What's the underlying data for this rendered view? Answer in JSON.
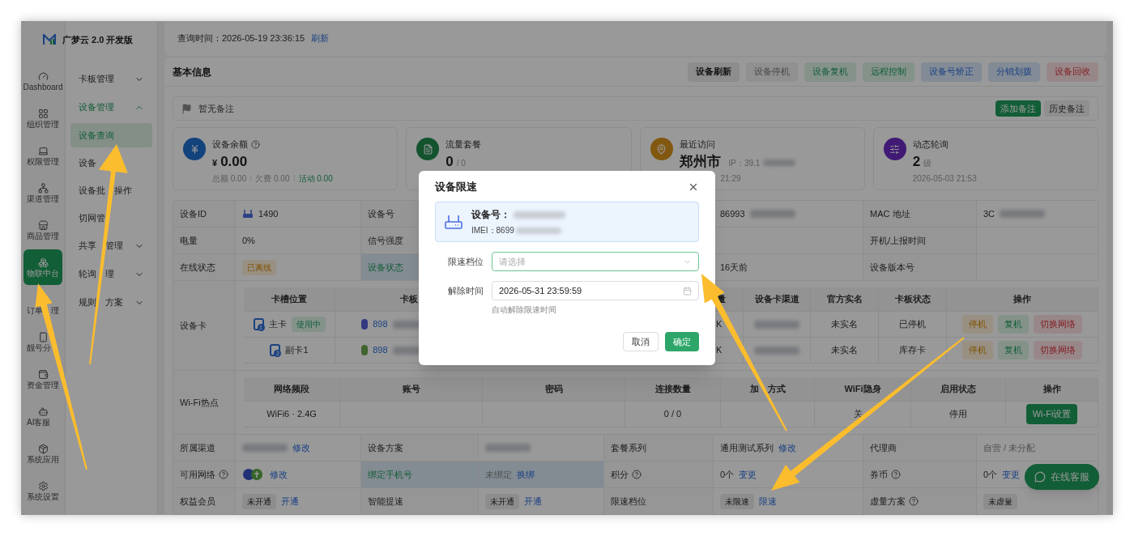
{
  "app": {
    "logo_text": "广梦云 2.0 开发版"
  },
  "rail": [
    {
      "label": "Dashboard",
      "selected": false
    },
    {
      "label": "组织管理",
      "selected": false
    },
    {
      "label": "权限管理",
      "selected": false
    },
    {
      "label": "渠道管理",
      "selected": false
    },
    {
      "label": "商品管理",
      "selected": false
    },
    {
      "label": "物联中台",
      "selected": true
    },
    {
      "label": "订单　理",
      "selected": false
    },
    {
      "label": "靓号分",
      "selected": false
    },
    {
      "label": "资金管理",
      "selected": false
    },
    {
      "label": "AI客服",
      "selected": false
    },
    {
      "label": "系统应用",
      "selected": false
    },
    {
      "label": "系统设置",
      "selected": false
    }
  ],
  "submenu": [
    {
      "label": "卡板管理",
      "active": false,
      "expanded": false
    },
    {
      "label": "设备管理",
      "active": true,
      "expanded": true,
      "children": [
        {
          "label": "设备查询",
          "selected": true
        },
        {
          "label": "设备",
          "selected": false
        },
        {
          "label": "设备批　操作",
          "selected": false
        },
        {
          "label": "切网管",
          "selected": false
        }
      ]
    },
    {
      "label": "共享　管理",
      "active": false,
      "expanded": false
    },
    {
      "label": "轮询　理",
      "active": false,
      "expanded": false
    },
    {
      "label": "规则　方案",
      "active": false,
      "expanded": false
    }
  ],
  "query_bar": {
    "label": "查询时间：2026-05-19 23:36:15",
    "link": "刷新"
  },
  "section": {
    "title": "基本信息",
    "actions": [
      {
        "text": "设备刷新",
        "kind": "strong"
      },
      {
        "text": "设备停机",
        "kind": "muted"
      },
      {
        "text": "设备复机",
        "kind": "success"
      },
      {
        "text": "远程控制",
        "kind": "success"
      },
      {
        "text": "设备号矫正",
        "kind": "info"
      },
      {
        "text": "分销划拨",
        "kind": "info"
      },
      {
        "text": "设备回收",
        "kind": "danger"
      }
    ]
  },
  "note": {
    "text": "暂无备注",
    "actions": [
      {
        "text": "添加备注",
        "primary": true
      },
      {
        "text": "历史备注",
        "primary": false
      }
    ]
  },
  "stats": [
    {
      "title": "设备余额",
      "hint": true,
      "color": "#13437d",
      "prefix": "¥",
      "value": "0.00",
      "sub": [
        {
          "kind": "text",
          "text": "总额 0.00"
        },
        {
          "kind": "text",
          "text": "欠费 0.00"
        },
        {
          "kind": "success",
          "text": "活动 0.00"
        }
      ]
    },
    {
      "title": "流量套餐",
      "hint": false,
      "color": "#13532e",
      "value": "0",
      "suffix": "/ 0"
    },
    {
      "title": "最近访问",
      "hint": false,
      "color": "#825811",
      "value": "郑州市",
      "extra": "IP：39.1",
      "sub": [
        {
          "kind": "blank"
        },
        {
          "kind": "text",
          "text": "21:29"
        }
      ]
    },
    {
      "title": "动态轮询",
      "hint": false,
      "color": "#401a74",
      "value": "2",
      "suffix": "级",
      "sub": [
        {
          "kind": "text",
          "text": "2026-05-03 21:53"
        }
      ]
    }
  ],
  "table": {
    "rows": [
      {
        "kind": "fields",
        "cells": [
          {
            "kind": "label",
            "text": "设备ID"
          },
          {
            "kind": "value",
            "parts": [
              {
                "kind": "device_icon"
              },
              {
                "kind": "text",
                "text": "1490"
              }
            ]
          },
          {
            "kind": "label",
            "text": "设备号"
          },
          {
            "kind": "blank"
          },
          {
            "kind": "blank"
          },
          {
            "kind": "value",
            "parts": [
              {
                "kind": "text",
                "text": "86993"
              },
              {
                "kind": "redacted"
              }
            ]
          },
          {
            "kind": "label",
            "text": "MAC 地址"
          },
          {
            "kind": "value",
            "parts": [
              {
                "kind": "text",
                "text": "3C"
              },
              {
                "kind": "redacted"
              }
            ]
          }
        ]
      },
      {
        "kind": "fields",
        "cells": [
          {
            "kind": "label",
            "text": "电量"
          },
          {
            "kind": "value",
            "parts": [
              {
                "kind": "text",
                "text": "0%"
              }
            ]
          },
          {
            "kind": "label",
            "text": "信号强度"
          },
          {
            "kind": "blank"
          },
          {
            "kind": "blank"
          },
          {
            "kind": "blank"
          },
          {
            "kind": "label",
            "text": "开机/上报时间"
          },
          {
            "kind": "blank"
          }
        ]
      },
      {
        "kind": "fields",
        "cells": [
          {
            "kind": "label",
            "text": "在线状态"
          },
          {
            "kind": "value",
            "parts": [
              {
                "kind": "warning_tag",
                "text": "已离线"
              }
            ]
          },
          {
            "kind": "label",
            "text": "设备状态",
            "highlight": true
          },
          {
            "kind": "blank"
          },
          {
            "kind": "blank"
          },
          {
            "kind": "value",
            "parts": [
              {
                "kind": "text",
                "text": "16天前"
              }
            ]
          },
          {
            "kind": "label",
            "text": "设备版本号"
          },
          {
            "kind": "blank"
          }
        ]
      },
      {
        "kind": "cards",
        "label": "设备卡",
        "columns": [
          {
            "kind": "header",
            "text": "卡槽位置"
          },
          {
            "kind": "header",
            "text": "卡板"
          },
          {
            "kind": "blank"
          },
          {
            "kind": "header",
            "text": "量"
          },
          {
            "kind": "header",
            "text": "设备卡渠道"
          },
          {
            "kind": "header",
            "text": "官方实名"
          },
          {
            "kind": "header",
            "text": "卡板状态"
          },
          {
            "kind": "header",
            "text": "操作"
          }
        ],
        "rows": [
          [
            {
              "kind": "value",
              "parts": [
                {
                  "kind": "sim_icon",
                  "text": "1"
                },
                {
                  "kind": "text",
                  "text": "主卡"
                },
                {
                  "kind": "success_tag",
                  "text": "使用中"
                }
              ]
            },
            {
              "kind": "value",
              "parts": [
                {
                  "kind": "card_icon",
                  "color": "#323a80"
                },
                {
                  "kind": "link",
                  "text": "898"
                },
                {
                  "kind": "redacted"
                }
              ]
            },
            {
              "kind": "blank"
            },
            {
              "kind": "value",
              "parts": [
                {
                  "kind": "text",
                  "text": "K"
                }
              ]
            },
            {
              "kind": "value",
              "parts": [
                {
                  "kind": "redacted"
                }
              ]
            },
            {
              "kind": "value",
              "parts": [
                {
                  "kind": "text",
                  "text": "未实名"
                }
              ]
            },
            {
              "kind": "value",
              "parts": [
                {
                  "kind": "text",
                  "text": "已停机"
                }
              ]
            },
            {
              "kind": "value",
              "parts": [
                {
                  "kind": "warning_action",
                  "text": "停机"
                },
                {
                  "kind": "success_action",
                  "text": "复机"
                },
                {
                  "kind": "danger_action",
                  "text": "切换网络"
                }
              ]
            }
          ],
          [
            {
              "kind": "value",
              "parts": [
                {
                  "kind": "sim_icon",
                  "text": "2"
                },
                {
                  "kind": "text",
                  "text": "副卡1"
                }
              ]
            },
            {
              "kind": "value",
              "parts": [
                {
                  "kind": "card_icon",
                  "color": "#40652f"
                },
                {
                  "kind": "link",
                  "text": "898"
                },
                {
                  "kind": "redacted"
                }
              ]
            },
            {
              "kind": "blank"
            },
            {
              "kind": "value",
              "parts": [
                {
                  "kind": "text",
                  "text": "K"
                }
              ]
            },
            {
              "kind": "value",
              "parts": [
                {
                  "kind": "redacted"
                }
              ]
            },
            {
              "kind": "value",
              "parts": [
                {
                  "kind": "text",
                  "text": "未实名"
                }
              ]
            },
            {
              "kind": "value",
              "parts": [
                {
                  "kind": "text",
                  "text": "库存卡"
                }
              ]
            },
            {
              "kind": "value",
              "parts": [
                {
                  "kind": "warning_action",
                  "text": "停机"
                },
                {
                  "kind": "success_action",
                  "text": "复机"
                },
                {
                  "kind": "danger_action",
                  "text": "切换网络"
                }
              ]
            }
          ]
        ]
      },
      {
        "kind": "wifi",
        "label": "Wi-Fi热点",
        "columns": [
          {
            "kind": "header",
            "text": "网络频段"
          },
          {
            "kind": "header",
            "text": "账号"
          },
          {
            "kind": "header",
            "text": "密码"
          },
          {
            "kind": "header",
            "text": "连接数量"
          },
          {
            "kind": "header",
            "text": "加　方式"
          },
          {
            "kind": "header",
            "text": "WiFi隐身"
          },
          {
            "kind": "header",
            "text": "启用状态"
          },
          {
            "kind": "header",
            "text": "操作"
          }
        ],
        "rows": [
          [
            {
              "kind": "value",
              "parts": [
                {
                  "kind": "text",
                  "text": "WiFi6 · 2.4G"
                }
              ]
            },
            {
              "kind": "blank"
            },
            {
              "kind": "blank"
            },
            {
              "kind": "value",
              "parts": [
                {
                  "kind": "text",
                  "text": "0 / 0"
                }
              ]
            },
            {
              "kind": "blank"
            },
            {
              "kind": "value",
              "parts": [
                {
                  "kind": "text",
                  "text": "关"
                }
              ]
            },
            {
              "kind": "value",
              "parts": [
                {
                  "kind": "text",
                  "text": "停用"
                }
              ]
            },
            {
              "kind": "value",
              "parts": [
                {
                  "kind": "button",
                  "text": "Wi-Fi设置"
                }
              ]
            }
          ]
        ]
      },
      {
        "kind": "fields",
        "cells": [
          {
            "kind": "label",
            "text": "所属渠道"
          },
          {
            "kind": "value",
            "parts": [
              {
                "kind": "redacted"
              },
              {
                "kind": "link",
                "text": "修改"
              }
            ]
          },
          {
            "kind": "label",
            "text": "设备方案"
          },
          {
            "kind": "value",
            "parts": [
              {
                "kind": "redacted"
              }
            ]
          },
          {
            "kind": "label",
            "text": "套餐系列"
          },
          {
            "kind": "value",
            "parts": [
              {
                "kind": "text",
                "text": "通用测试系列"
              },
              {
                "kind": "link",
                "text": "修改"
              }
            ]
          },
          {
            "kind": "label",
            "text": "代理商"
          },
          {
            "kind": "value",
            "parts": [
              {
                "kind": "muted",
                "text": "自营 / 未分配"
              }
            ]
          }
        ]
      },
      {
        "kind": "fields",
        "cells": [
          {
            "kind": "label",
            "text": "可用网络",
            "hint": true
          },
          {
            "kind": "value",
            "parts": [
              {
                "kind": "network_icons"
              },
              {
                "kind": "link",
                "text": "修改"
              }
            ]
          },
          {
            "kind": "label",
            "text": "绑定手机号",
            "highlight": true
          },
          {
            "kind": "value",
            "highlight": true,
            "parts": [
              {
                "kind": "muted",
                "text": "未绑定"
              },
              {
                "kind": "link",
                "text": "换绑"
              }
            ]
          },
          {
            "kind": "label",
            "text": "积分",
            "hint": true
          },
          {
            "kind": "value",
            "parts": [
              {
                "kind": "text",
                "text": "0个"
              },
              {
                "kind": "link",
                "text": "变更"
              }
            ]
          },
          {
            "kind": "label",
            "text": "券币",
            "hint": true
          },
          {
            "kind": "value",
            "parts": [
              {
                "kind": "text",
                "text": "0个"
              },
              {
                "kind": "link",
                "text": "变更"
              }
            ]
          }
        ]
      },
      {
        "kind": "fields",
        "cells": [
          {
            "kind": "label",
            "text": "权益会员"
          },
          {
            "kind": "value",
            "parts": [
              {
                "kind": "tag",
                "text": "未开通"
              },
              {
                "kind": "link",
                "text": "开通"
              }
            ]
          },
          {
            "kind": "label",
            "text": "智能提速"
          },
          {
            "kind": "value",
            "parts": [
              {
                "kind": "tag",
                "text": "未开通"
              },
              {
                "kind": "link",
                "text": "开通"
              }
            ]
          },
          {
            "kind": "label",
            "text": "限速档位"
          },
          {
            "kind": "value",
            "parts": [
              {
                "kind": "tag",
                "text": "未限速"
              },
              {
                "kind": "link",
                "text": "限速"
              }
            ]
          },
          {
            "kind": "label",
            "text": "虚量方案",
            "hint": true
          },
          {
            "kind": "value",
            "parts": [
              {
                "kind": "tag",
                "text": "未虚量"
              }
            ]
          }
        ]
      }
    ]
  },
  "chat_button": {
    "text": "在线客服"
  },
  "dialog": {
    "title": "设备限速",
    "device_label": "设备号：",
    "imei_label": "IMEI：8699",
    "fields": [
      {
        "kind": "select",
        "label": "限速档位",
        "placeholder": "请选择",
        "focused": true
      },
      {
        "kind": "date",
        "label": "解除时间",
        "value": "2026-05-31 23:59:59",
        "help": "自动解除限速时间",
        "focused": false
      }
    ],
    "buttons": [
      {
        "text": "取消",
        "primary": false
      },
      {
        "text": "确定",
        "primary": true
      }
    ]
  }
}
